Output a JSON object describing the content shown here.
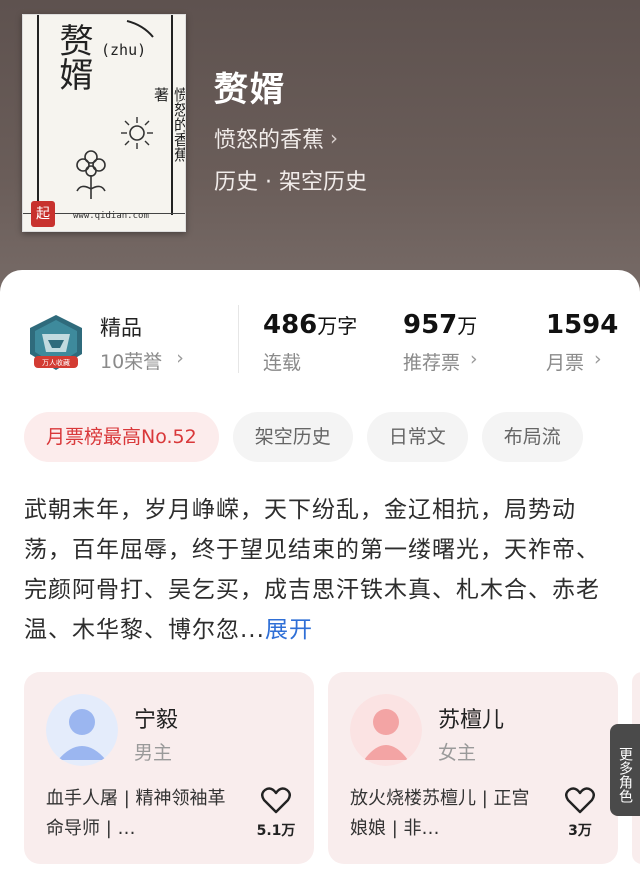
{
  "book": {
    "title": "赘婿",
    "author": "愤怒的香蕉",
    "genre": "历史 · 架空历史",
    "cover": {
      "title": "赘婿",
      "pinyin": "(zhu)",
      "author": "愤怒的香蕉",
      "author_suffix": "著",
      "site": "www.qidian.com",
      "stamp": "起"
    }
  },
  "stats": {
    "quality": {
      "title": "精品",
      "sub": "10荣誉",
      "badge_text": "万人收藏"
    },
    "words": {
      "value": "486",
      "unit": "万字",
      "label": "连载"
    },
    "recommend": {
      "value": "957",
      "unit": "万",
      "label": "推荐票"
    },
    "monthly": {
      "value": "1594",
      "unit": "",
      "label": "月票"
    }
  },
  "tags": [
    {
      "label": "月票榜最高No.52",
      "hot": true
    },
    {
      "label": "架空历史",
      "hot": false
    },
    {
      "label": "日常文",
      "hot": false
    },
    {
      "label": "布局流",
      "hot": false
    }
  ],
  "synopsis": {
    "text": "武朝末年，岁月峥嵘，天下纷乱，金辽相抗，局势动荡，百年屈辱，终于望见结束的第一缕曙光，天祚帝、完颜阿骨打、吴乞买，成吉思汗铁木真、札木合、赤老温、木华黎、博尔忽...",
    "more": "展开"
  },
  "roles": [
    {
      "name": "宁毅",
      "type": "男主",
      "desc": "血手人屠 | 精神领袖革命导师 | …",
      "likes": "5.1万",
      "avatar_color": "#9bb6f0"
    },
    {
      "name": "苏檀儿",
      "type": "女主",
      "desc": "放火烧楼苏檀儿 | 正宫娘娘 | 非…",
      "likes": "3万",
      "avatar_color": "#f3a4a4"
    }
  ],
  "more_roles": "更多角色",
  "colors": {
    "hero_bg": "#5e524f",
    "hot_tag": "#d9383a",
    "link": "#2f6fd6",
    "card_bg": "#f9eded"
  }
}
